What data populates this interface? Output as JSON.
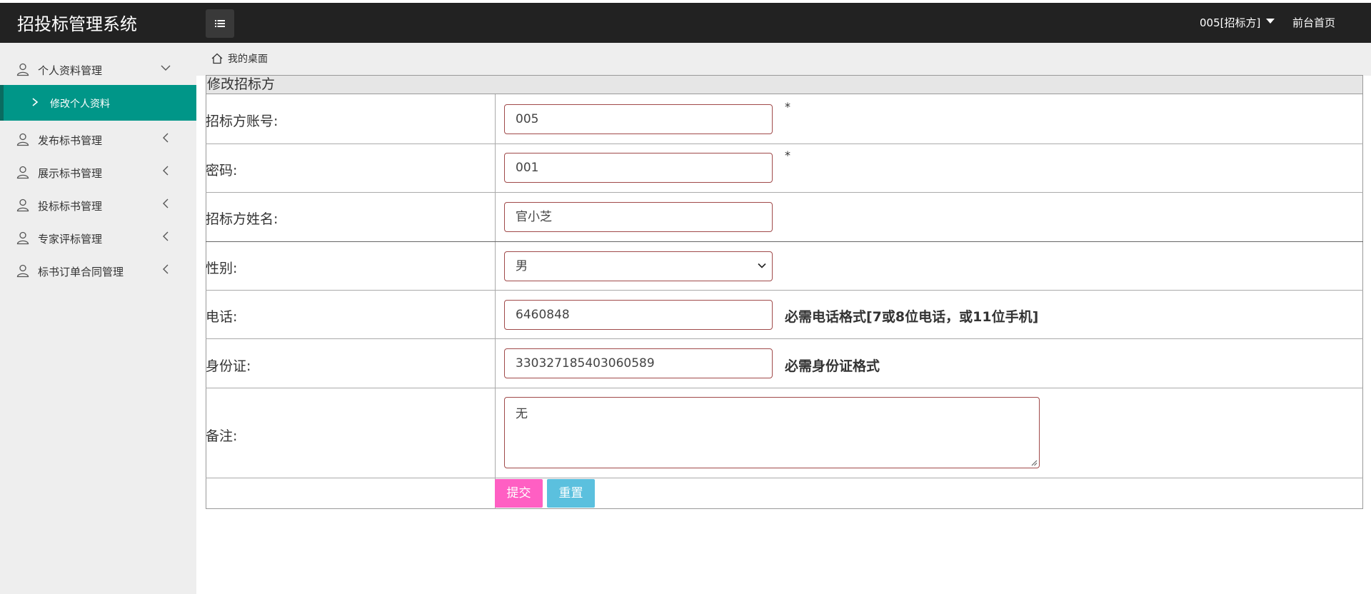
{
  "header": {
    "app_title": "招投标管理系统",
    "user_menu": "005[招标方]",
    "front_link": "前台首页"
  },
  "sidebar": {
    "items": [
      {
        "label": "个人资料管理",
        "expanded": true
      },
      {
        "label": "发布标书管理",
        "expanded": false
      },
      {
        "label": "展示标书管理",
        "expanded": false
      },
      {
        "label": "投标标书管理",
        "expanded": false
      },
      {
        "label": "专家评标管理",
        "expanded": false
      },
      {
        "label": "标书订单合同管理",
        "expanded": false
      }
    ],
    "active_sub": "修改个人资料",
    "active_color": "#009688"
  },
  "breadcrumb": {
    "home": "我的桌面"
  },
  "form": {
    "title": "修改招标方",
    "account": {
      "label": "招标方账号:",
      "value": "005",
      "mark": "*"
    },
    "password": {
      "label": "密码:",
      "value": "001",
      "mark": "*"
    },
    "name": {
      "label": "招标方姓名:",
      "value": "官小芝"
    },
    "gender": {
      "label": "性别:",
      "value": "男"
    },
    "phone": {
      "label": "电话:",
      "value": "6460848",
      "hint": "必需电话格式[7或8位电话，或11位手机]"
    },
    "idcard": {
      "label": "身份证:",
      "value": "330327185403060589",
      "hint": "必需身份证格式"
    },
    "remark": {
      "label": "备注:",
      "value": "无"
    },
    "submit_label": "提交",
    "reset_label": "重置",
    "submit_color": "#ff5fc3",
    "reset_color": "#5bc0de"
  }
}
